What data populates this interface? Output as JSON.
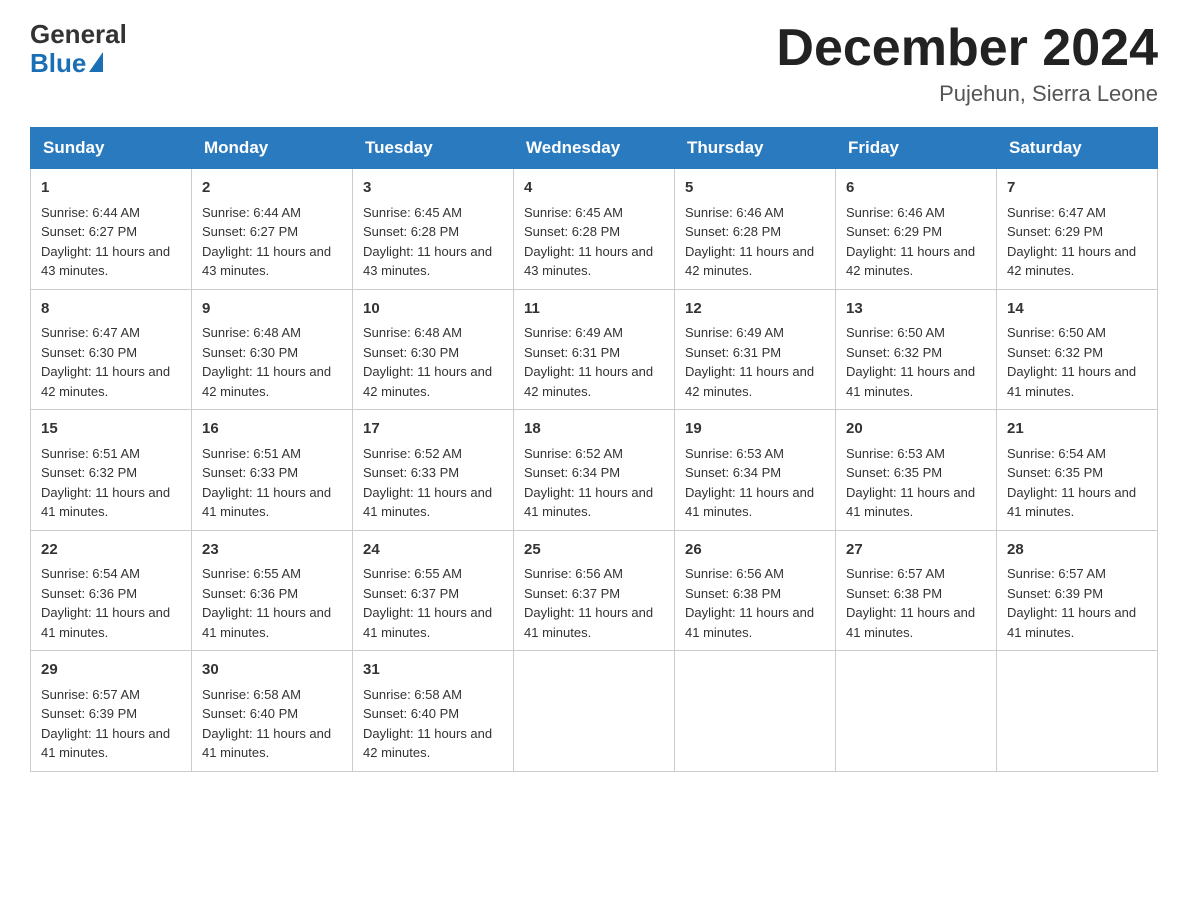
{
  "logo": {
    "general": "General",
    "blue": "Blue"
  },
  "title": "December 2024",
  "subtitle": "Pujehun, Sierra Leone",
  "headers": [
    "Sunday",
    "Monday",
    "Tuesday",
    "Wednesday",
    "Thursday",
    "Friday",
    "Saturday"
  ],
  "weeks": [
    [
      {
        "day": "1",
        "sunrise": "6:44 AM",
        "sunset": "6:27 PM",
        "daylight": "11 hours and 43 minutes."
      },
      {
        "day": "2",
        "sunrise": "6:44 AM",
        "sunset": "6:27 PM",
        "daylight": "11 hours and 43 minutes."
      },
      {
        "day": "3",
        "sunrise": "6:45 AM",
        "sunset": "6:28 PM",
        "daylight": "11 hours and 43 minutes."
      },
      {
        "day": "4",
        "sunrise": "6:45 AM",
        "sunset": "6:28 PM",
        "daylight": "11 hours and 43 minutes."
      },
      {
        "day": "5",
        "sunrise": "6:46 AM",
        "sunset": "6:28 PM",
        "daylight": "11 hours and 42 minutes."
      },
      {
        "day": "6",
        "sunrise": "6:46 AM",
        "sunset": "6:29 PM",
        "daylight": "11 hours and 42 minutes."
      },
      {
        "day": "7",
        "sunrise": "6:47 AM",
        "sunset": "6:29 PM",
        "daylight": "11 hours and 42 minutes."
      }
    ],
    [
      {
        "day": "8",
        "sunrise": "6:47 AM",
        "sunset": "6:30 PM",
        "daylight": "11 hours and 42 minutes."
      },
      {
        "day": "9",
        "sunrise": "6:48 AM",
        "sunset": "6:30 PM",
        "daylight": "11 hours and 42 minutes."
      },
      {
        "day": "10",
        "sunrise": "6:48 AM",
        "sunset": "6:30 PM",
        "daylight": "11 hours and 42 minutes."
      },
      {
        "day": "11",
        "sunrise": "6:49 AM",
        "sunset": "6:31 PM",
        "daylight": "11 hours and 42 minutes."
      },
      {
        "day": "12",
        "sunrise": "6:49 AM",
        "sunset": "6:31 PM",
        "daylight": "11 hours and 42 minutes."
      },
      {
        "day": "13",
        "sunrise": "6:50 AM",
        "sunset": "6:32 PM",
        "daylight": "11 hours and 41 minutes."
      },
      {
        "day": "14",
        "sunrise": "6:50 AM",
        "sunset": "6:32 PM",
        "daylight": "11 hours and 41 minutes."
      }
    ],
    [
      {
        "day": "15",
        "sunrise": "6:51 AM",
        "sunset": "6:32 PM",
        "daylight": "11 hours and 41 minutes."
      },
      {
        "day": "16",
        "sunrise": "6:51 AM",
        "sunset": "6:33 PM",
        "daylight": "11 hours and 41 minutes."
      },
      {
        "day": "17",
        "sunrise": "6:52 AM",
        "sunset": "6:33 PM",
        "daylight": "11 hours and 41 minutes."
      },
      {
        "day": "18",
        "sunrise": "6:52 AM",
        "sunset": "6:34 PM",
        "daylight": "11 hours and 41 minutes."
      },
      {
        "day": "19",
        "sunrise": "6:53 AM",
        "sunset": "6:34 PM",
        "daylight": "11 hours and 41 minutes."
      },
      {
        "day": "20",
        "sunrise": "6:53 AM",
        "sunset": "6:35 PM",
        "daylight": "11 hours and 41 minutes."
      },
      {
        "day": "21",
        "sunrise": "6:54 AM",
        "sunset": "6:35 PM",
        "daylight": "11 hours and 41 minutes."
      }
    ],
    [
      {
        "day": "22",
        "sunrise": "6:54 AM",
        "sunset": "6:36 PM",
        "daylight": "11 hours and 41 minutes."
      },
      {
        "day": "23",
        "sunrise": "6:55 AM",
        "sunset": "6:36 PM",
        "daylight": "11 hours and 41 minutes."
      },
      {
        "day": "24",
        "sunrise": "6:55 AM",
        "sunset": "6:37 PM",
        "daylight": "11 hours and 41 minutes."
      },
      {
        "day": "25",
        "sunrise": "6:56 AM",
        "sunset": "6:37 PM",
        "daylight": "11 hours and 41 minutes."
      },
      {
        "day": "26",
        "sunrise": "6:56 AM",
        "sunset": "6:38 PM",
        "daylight": "11 hours and 41 minutes."
      },
      {
        "day": "27",
        "sunrise": "6:57 AM",
        "sunset": "6:38 PM",
        "daylight": "11 hours and 41 minutes."
      },
      {
        "day": "28",
        "sunrise": "6:57 AM",
        "sunset": "6:39 PM",
        "daylight": "11 hours and 41 minutes."
      }
    ],
    [
      {
        "day": "29",
        "sunrise": "6:57 AM",
        "sunset": "6:39 PM",
        "daylight": "11 hours and 41 minutes."
      },
      {
        "day": "30",
        "sunrise": "6:58 AM",
        "sunset": "6:40 PM",
        "daylight": "11 hours and 41 minutes."
      },
      {
        "day": "31",
        "sunrise": "6:58 AM",
        "sunset": "6:40 PM",
        "daylight": "11 hours and 42 minutes."
      },
      null,
      null,
      null,
      null
    ]
  ],
  "labels": {
    "sunrise": "Sunrise:",
    "sunset": "Sunset:",
    "daylight": "Daylight:"
  }
}
